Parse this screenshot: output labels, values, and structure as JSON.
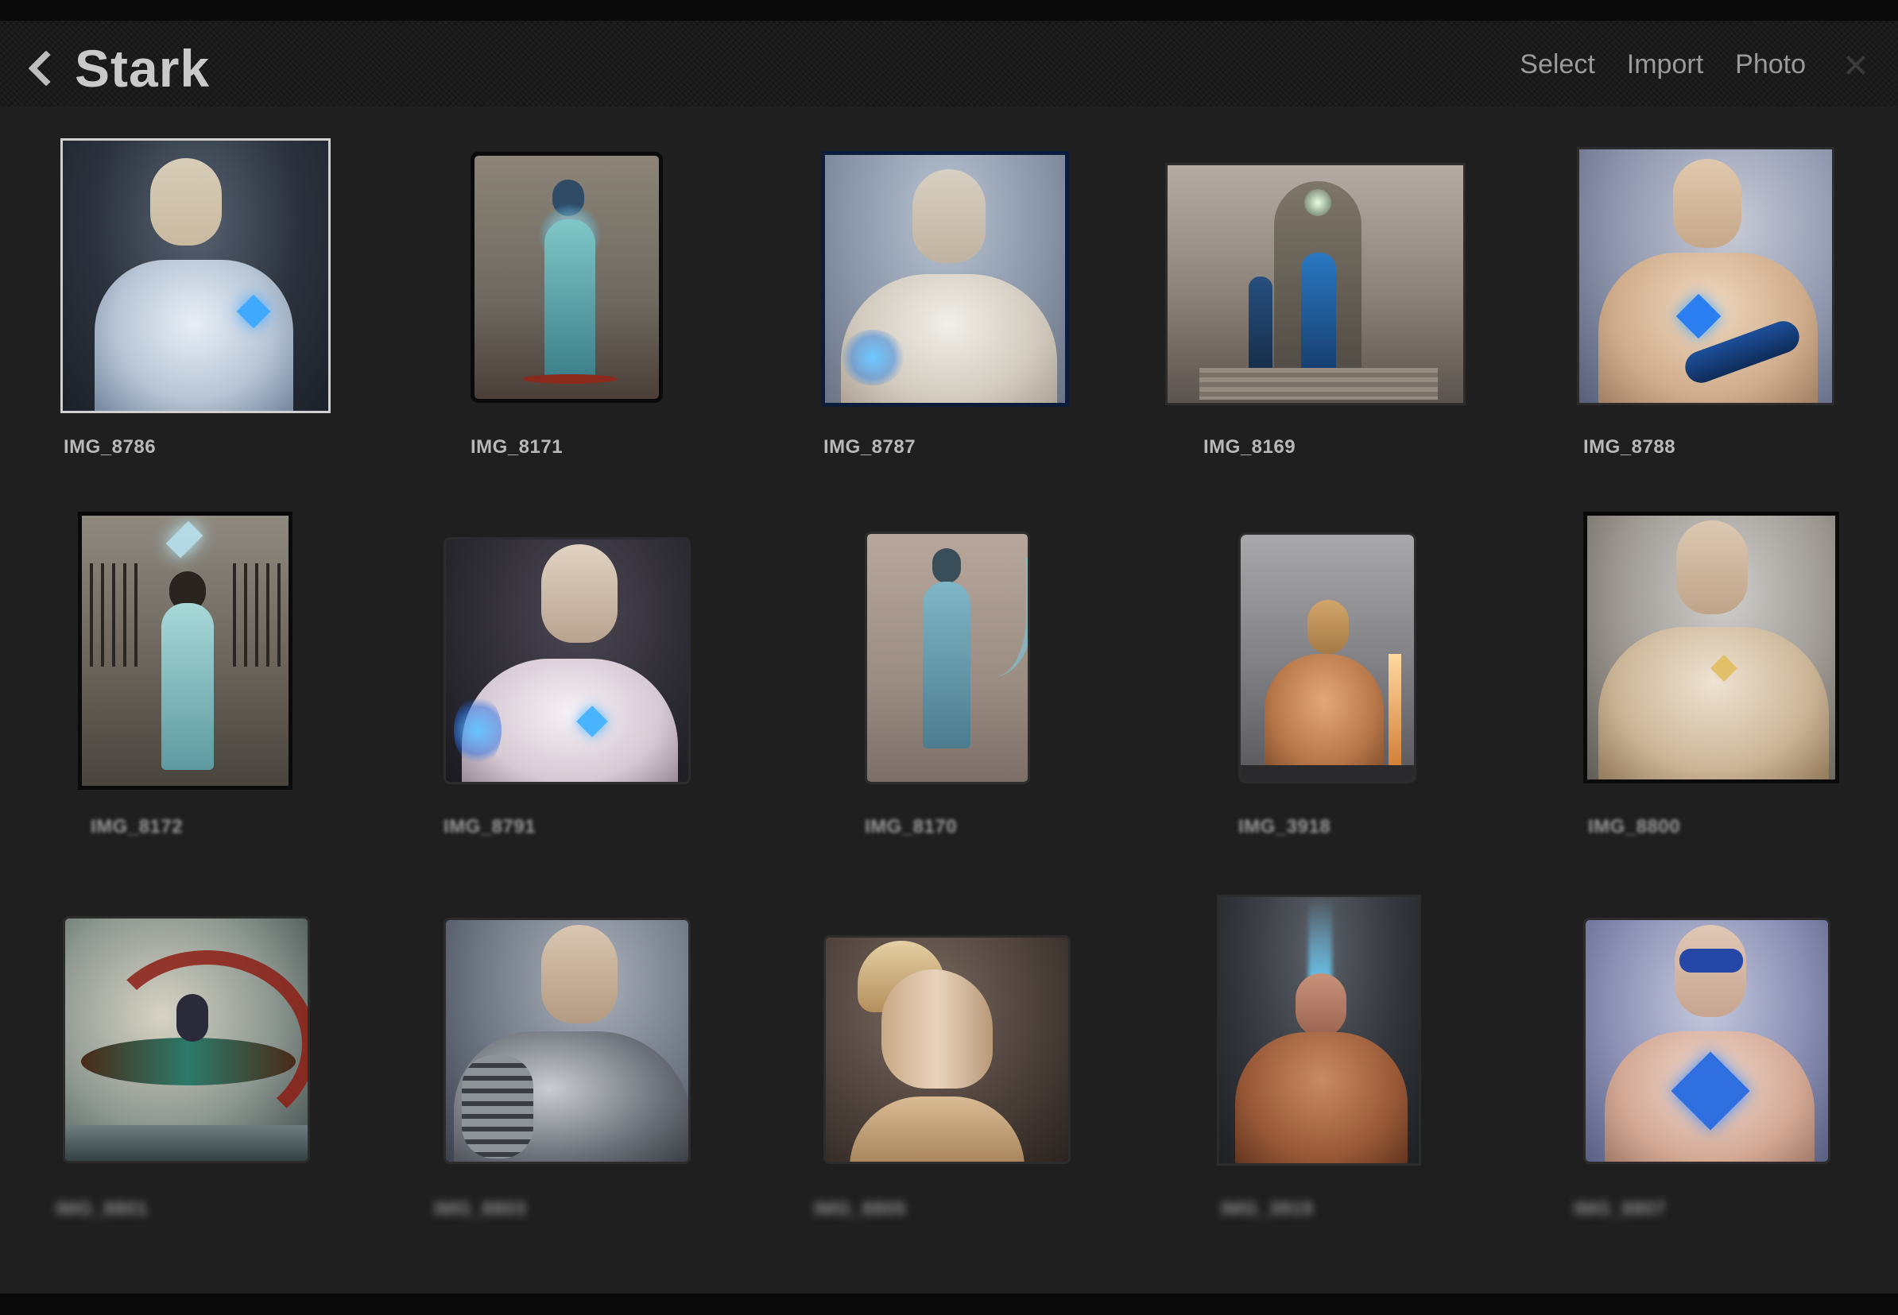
{
  "header": {
    "title": "Stark",
    "actions": {
      "select": "Select",
      "import": "Import",
      "photo": "Photo"
    }
  },
  "photos": [
    {
      "name": "IMG_8786"
    },
    {
      "name": "IMG_8171"
    },
    {
      "name": "IMG_8787"
    },
    {
      "name": "IMG_8169"
    },
    {
      "name": "IMG_8788"
    },
    {
      "name": "IMG_8172"
    },
    {
      "name": "IMG_8791"
    },
    {
      "name": "IMG_8170"
    },
    {
      "name": "IMG_3918"
    },
    {
      "name": "IMG_8800"
    },
    {
      "name": "IMG_8801"
    },
    {
      "name": "IMG_8803"
    },
    {
      "name": "IMG_8805"
    },
    {
      "name": "IMG_3919"
    },
    {
      "name": "IMG_8807"
    }
  ]
}
